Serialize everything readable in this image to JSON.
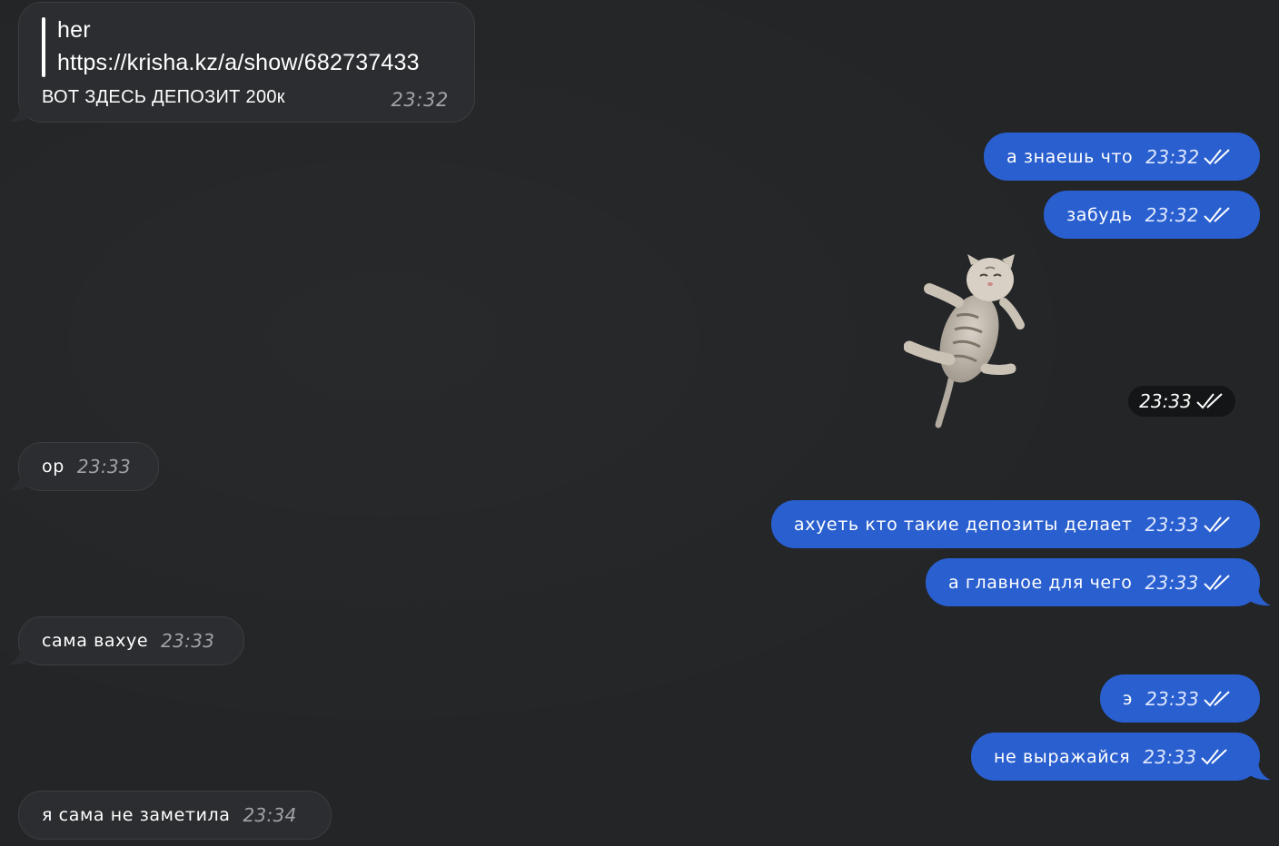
{
  "messages": [
    {
      "direction": "incoming",
      "quote_author": "her",
      "quote_text": "https://krisha.kz/a/show/682737433",
      "text": "ВОТ ЗДЕСЬ ДЕПОЗИТ 200к",
      "time": "23:32"
    },
    {
      "direction": "outgoing",
      "text": "а знаешь что",
      "time": "23:32",
      "status": "read"
    },
    {
      "direction": "outgoing",
      "text": "забудь",
      "time": "23:32",
      "status": "read"
    },
    {
      "direction": "outgoing",
      "type": "sticker",
      "sticker": "kitten-sticker",
      "time": "23:33",
      "status": "read"
    },
    {
      "direction": "incoming",
      "text": "ор",
      "time": "23:33"
    },
    {
      "direction": "outgoing",
      "text": "ахуеть кто такие депозиты делает",
      "time": "23:33",
      "status": "read"
    },
    {
      "direction": "outgoing",
      "text": "а главное для чего",
      "time": "23:33",
      "status": "read"
    },
    {
      "direction": "incoming",
      "text": "сама вахуе",
      "time": "23:33"
    },
    {
      "direction": "outgoing",
      "text": "э",
      "time": "23:33",
      "status": "read"
    },
    {
      "direction": "outgoing",
      "text": "не выражайся",
      "time": "23:33",
      "status": "read"
    },
    {
      "direction": "incoming",
      "text": "я сама не заметила",
      "time": "23:34"
    }
  ],
  "colors": {
    "background": "#232527",
    "incoming_bubble": "#2b2d30",
    "outgoing_bubble": "#2a5fcf",
    "incoming_time": "#9fa3a8"
  },
  "icons": {
    "read_status": "double-check-icon"
  }
}
